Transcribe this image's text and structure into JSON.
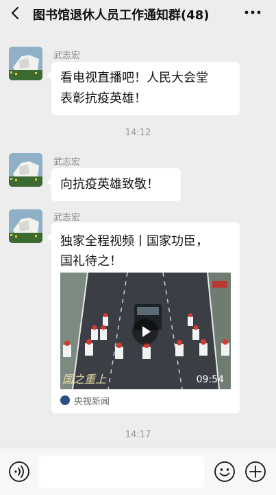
{
  "header": {
    "title": "图书馆退休人员工作通知群(48)",
    "back_icon": "chevron-left-icon",
    "more_icon": "more-dots-icon"
  },
  "messages": [
    {
      "sender": "武志宏",
      "text_lines": [
        "看电视直播吧！人民大会堂",
        "表彰抗疫英雄！"
      ]
    },
    {
      "time": "14:12"
    },
    {
      "sender": "武志宏",
      "text": "向抗疫英雄致敬！"
    },
    {
      "sender": "武志宏",
      "card": {
        "title_lines": [
          "独家全程视频丨国家功臣，",
          "国礼待之！"
        ],
        "duration": "09:54",
        "source": "央视新闻"
      }
    },
    {
      "time": "14:17"
    }
  ],
  "footer": {
    "input_value": "",
    "voice_icon": "voice-icon",
    "emoji_icon": "emoji-icon",
    "plus_icon": "plus-icon"
  },
  "colors": {
    "background": "#ededed",
    "bubble": "#ffffff",
    "sender_text": "#888888",
    "time_text": "#9a9a9a"
  }
}
